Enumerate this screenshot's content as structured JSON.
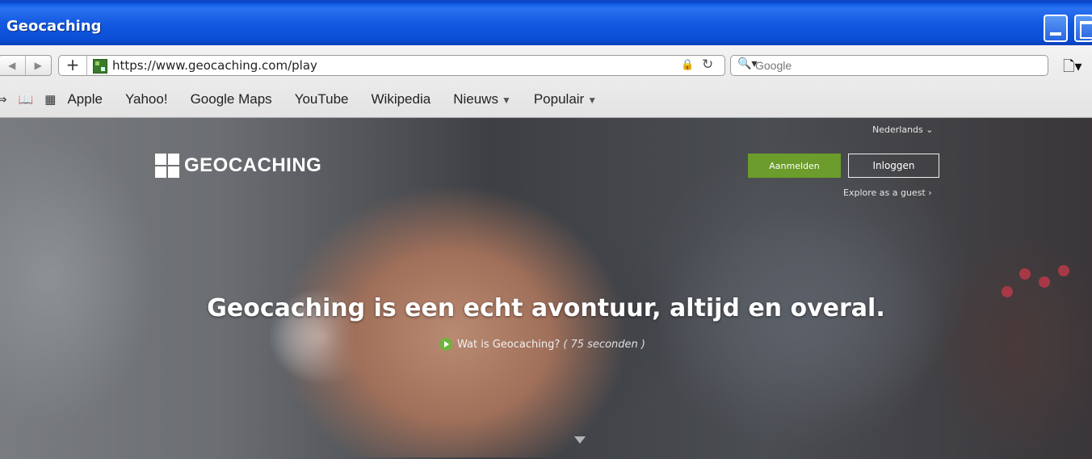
{
  "window": {
    "title": "Geocaching"
  },
  "toolbar": {
    "url": "https://www.geocaching.com/play",
    "search_placeholder": "Google"
  },
  "bookmarks": [
    {
      "label": "Apple"
    },
    {
      "label": "Yahoo!"
    },
    {
      "label": "Google Maps"
    },
    {
      "label": "YouTube"
    },
    {
      "label": "Wikipedia"
    },
    {
      "label": "Nieuws",
      "dropdown": true
    },
    {
      "label": "Populair",
      "dropdown": true
    }
  ],
  "page": {
    "logo_text": "GEOCACHING",
    "language": "Nederlands ⌄",
    "signup_label": "Aanmelden",
    "login_label": "Inloggen",
    "guest_link": "Explore as a guest ›",
    "headline": "Geocaching is een echt avontuur, altijd en overal.",
    "video_link": "Wat is Geocaching?",
    "video_duration": "( 75 seconden )",
    "brand_color": "#6c9c2b"
  }
}
